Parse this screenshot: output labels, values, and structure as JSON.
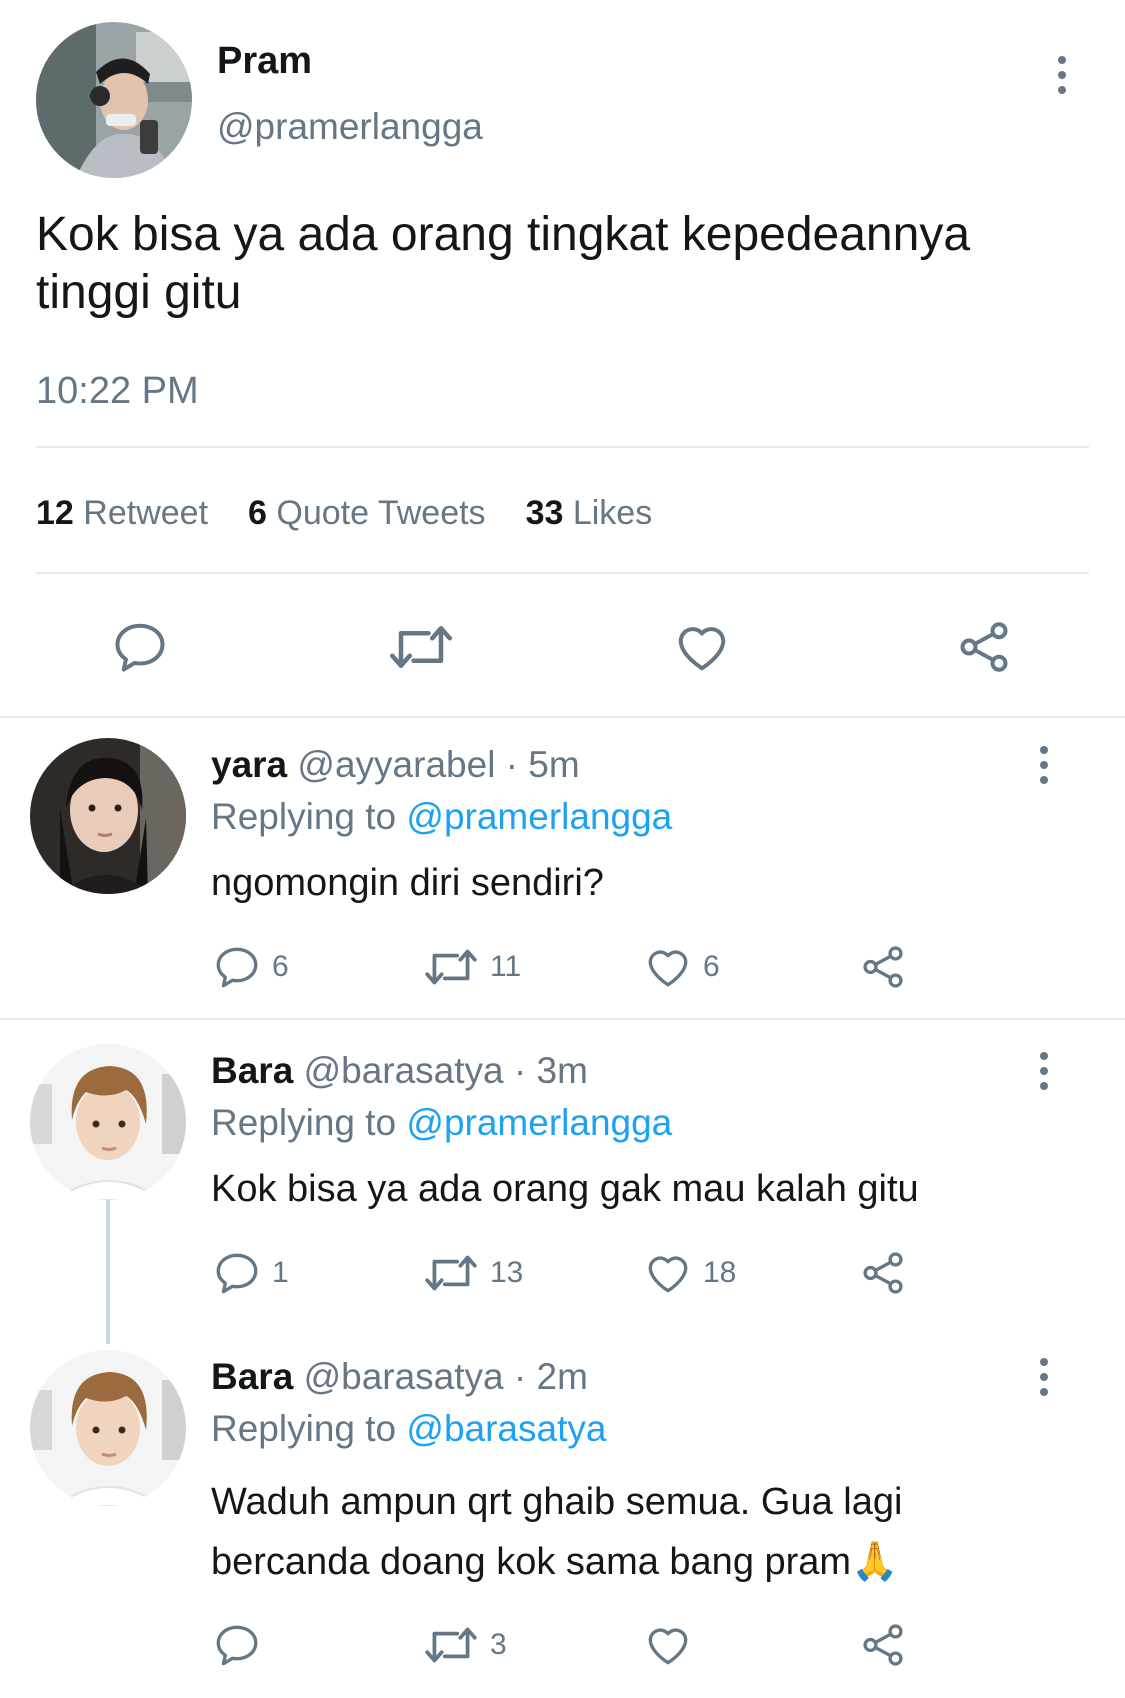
{
  "main_tweet": {
    "name": "Pram",
    "handle": "@pramerlangga",
    "text_line1": "Kok bisa ya ada orang tingkat kepedeannya",
    "text_line2": "tinggi gitu",
    "time": "10:22 PM",
    "stats": {
      "retweet_count": "12",
      "retweet_label": "Retweet",
      "quote_count": "6",
      "quote_label": "Quote Tweets",
      "likes_count": "33",
      "likes_label": "Likes"
    }
  },
  "replies": [
    {
      "name": "yara",
      "handle": "@ayyarabel",
      "time": "· 5m",
      "replying_prefix": "Replying to",
      "replying_to": "@pramerlangga",
      "text_line1": "ngomongin diri sendiri?",
      "text_line2": "",
      "reply_count": "6",
      "retweet_count": "11",
      "like_count": "6"
    },
    {
      "name": "Bara",
      "handle": "@barasatya",
      "time": "· 3m",
      "replying_prefix": "Replying to",
      "replying_to": "@pramerlangga",
      "text_line1": "Kok bisa ya ada orang gak mau kalah gitu",
      "text_line2": "",
      "reply_count": "1",
      "retweet_count": "13",
      "like_count": "18"
    },
    {
      "name": "Bara",
      "handle": "@barasatya",
      "time": "· 2m",
      "replying_prefix": "Replying to",
      "replying_to": "@barasatya",
      "text_line1": "Waduh ampun qrt ghaib semua. Gua lagi",
      "text_line2": "bercanda doang kok sama bang pram🙏",
      "reply_count": "",
      "retweet_count": "3",
      "like_count": ""
    }
  ],
  "icons": {
    "reply": "speech-bubble-icon",
    "retweet": "retweet-arrows-icon",
    "like": "heart-icon",
    "share": "share-nodes-icon",
    "more": "vertical-dots-icon"
  },
  "colors": {
    "link": "#1da1f2",
    "muted": "#657786",
    "divider": "#e6ecf0"
  }
}
